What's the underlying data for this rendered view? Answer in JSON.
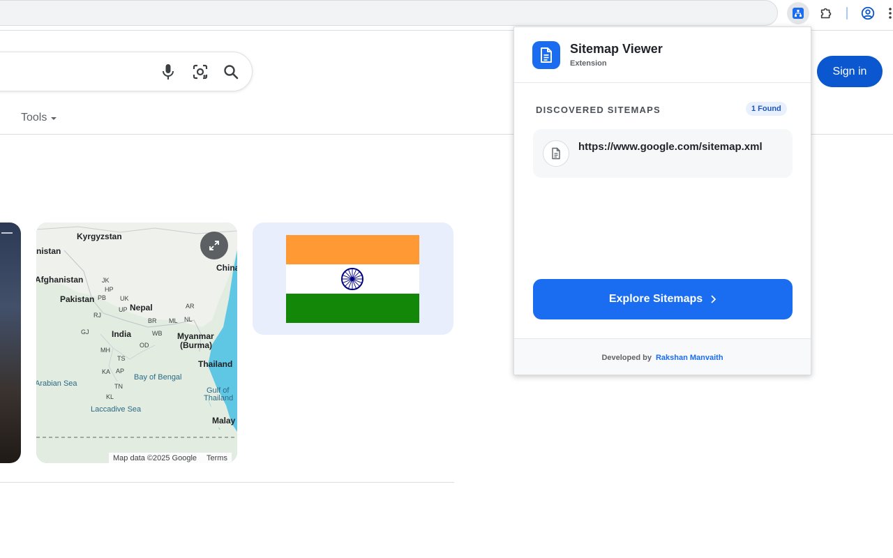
{
  "toolbar": {
    "active_extension_icon": "sitemap-icon",
    "extensions_icon": "puzzle-icon",
    "profile_icon": "profile-icon",
    "menu_icon": "kebab-menu-icon"
  },
  "search": {
    "mic_icon": "mic-icon",
    "lens_icon": "camera-lens-icon",
    "search_icon": "search-icon"
  },
  "header": {
    "sign_in_label": "Sign in",
    "tools_label": "Tools"
  },
  "map": {
    "labels": {
      "kyrgyzstan": "Kyrgyzstan",
      "nistan": "nistan",
      "china": "China",
      "afghanistan": "Afghanistan",
      "jk": "JK",
      "hp": "HP",
      "pakistan": "Pakistan",
      "pb": "PB",
      "uk": "UK",
      "up": "UP",
      "nepal": "Nepal",
      "ar": "AR",
      "rj": "RJ",
      "br": "BR",
      "ml": "ML",
      "nl": "NL",
      "gj": "GJ",
      "india": "India",
      "wb": "WB",
      "myanmar": "Myanmar",
      "burma": "(Burma)",
      "mh": "MH",
      "od": "OD",
      "ts": "TS",
      "thailand": "Thailand",
      "ka": "KA",
      "ap": "AP",
      "bay_of_bengal": "Bay of Bengal",
      "arabian_sea": "Arabian Sea",
      "tn": "TN",
      "gulf_of": "Gulf of",
      "gulf_thailand": "Thailand",
      "kl": "KL",
      "laccadive_sea": "Laccadive Sea",
      "malay": "Malay"
    },
    "attribution": "Map data ©2025 Google",
    "terms": "Terms",
    "expand_icon": "expand-icon"
  },
  "colors": {
    "brand_blue": "#1a6cf0",
    "google_blue": "#0b57d0",
    "flag_saffron": "#ff9933",
    "flag_green": "#138808",
    "flag_navy": "#000080"
  },
  "popup": {
    "title": "Sitemap Viewer",
    "subtitle": "Extension",
    "section_title": "DISCOVERED SITEMAPS",
    "badge": "1 Found",
    "sitemaps": [
      {
        "url": "https://www.google.com/sitemap.xml"
      }
    ],
    "explore_button": "Explore Sitemaps",
    "footer_label": "Developed by",
    "footer_author": "Rakshan Manvaith"
  }
}
